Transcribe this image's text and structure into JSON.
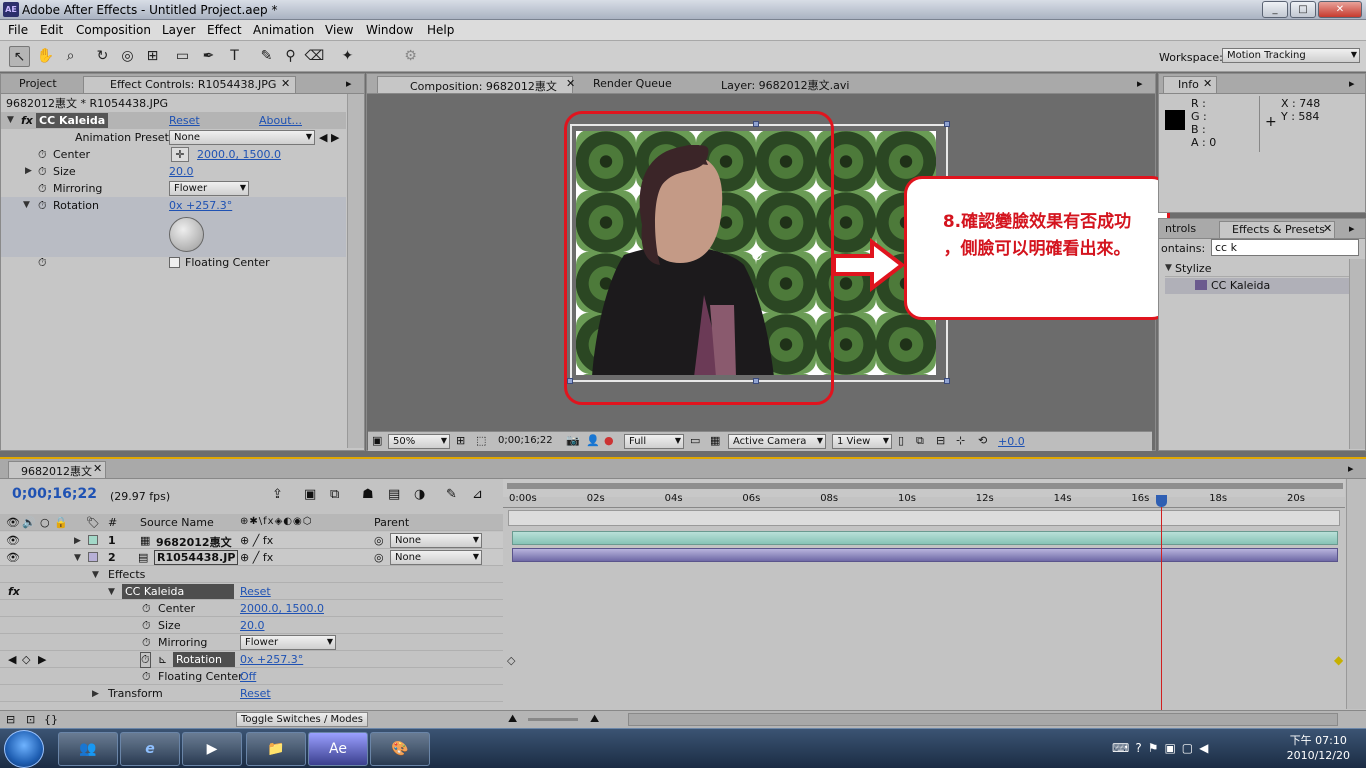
{
  "window": {
    "title": "Adobe After Effects - Untitled Project.aep *",
    "logo": "AE"
  },
  "menu": [
    "File",
    "Edit",
    "Composition",
    "Layer",
    "Effect",
    "Animation",
    "View",
    "Window",
    "Help"
  ],
  "toolbar": {
    "workspace_label": "Workspace:",
    "workspace_value": "Motion Tracking"
  },
  "left_panel": {
    "tabs": [
      "Project",
      "Effect Controls: R1054438.JPG"
    ],
    "breadcrumb": "9682012惠文 * R1054438.JPG",
    "effect_name": "CC Kaleida",
    "reset": "Reset",
    "about": "About...",
    "presets_label": "Animation Presets:",
    "presets_value": "None",
    "center_label": "Center",
    "center_value": "2000.0, 1500.0",
    "size_label": "Size",
    "size_value": "20.0",
    "mirroring_label": "Mirroring",
    "mirroring_value": "Flower",
    "rotation_label": "Rotation",
    "rotation_value": "0x +257.3°",
    "floating_label": "Floating Center"
  },
  "comp_panel": {
    "tabs": [
      "Composition: 9682012惠文",
      "Render Queue",
      "Layer: 9682012惠文.avi"
    ],
    "zoom": "50%",
    "timecode": "0;00;16;22",
    "resolution": "Full",
    "camera": "Active Camera",
    "view": "1 View",
    "exposure": "+0.0"
  },
  "callout": {
    "line1": "8.確認變臉效果有否成功",
    "line2": "，側臉可以明確看出來。"
  },
  "info_panel": {
    "tab": "Info",
    "r": "R :",
    "g": "G :",
    "b": "B :",
    "a": "A : 0",
    "x": "X : 748",
    "y": "Y : 584"
  },
  "effects_panel": {
    "tabs": [
      "ntrols",
      "Effects & Presets"
    ],
    "contains_label": "ontains:",
    "search": "cc k",
    "category": "Stylize",
    "item": "CC Kaleida"
  },
  "timeline": {
    "tab": "9682012惠文",
    "timecode": "0;00;16;22",
    "fps": "(29.97 fps)",
    "col_num": "#",
    "col_source": "Source Name",
    "col_parent": "Parent",
    "layers": [
      {
        "num": "1",
        "name": "9682012惠文",
        "parent": "None"
      },
      {
        "num": "2",
        "name": "R1054438.JP",
        "parent": "None"
      }
    ],
    "effects_label": "Effects",
    "effect_name": "CC Kaleida",
    "reset": "Reset",
    "center_label": "Center",
    "center_value": "2000.0, 1500.0",
    "size_label": "Size",
    "size_value": "20.0",
    "mirroring_label": "Mirroring",
    "mirroring_value": "Flower",
    "rotation_label": "Rotation",
    "rotation_value": "0x +257.3°",
    "floating_label": "Floating Center",
    "floating_value": "Off",
    "transform_label": "Transform",
    "transform_reset": "Reset",
    "toggle_label": "Toggle Switches / Modes",
    "ruler": [
      "0:00s",
      "02s",
      "04s",
      "06s",
      "08s",
      "10s",
      "12s",
      "14s",
      "16s",
      "18s",
      "20s"
    ]
  },
  "taskbar": {
    "time": "下午 07:10",
    "date": "2010/12/20"
  }
}
